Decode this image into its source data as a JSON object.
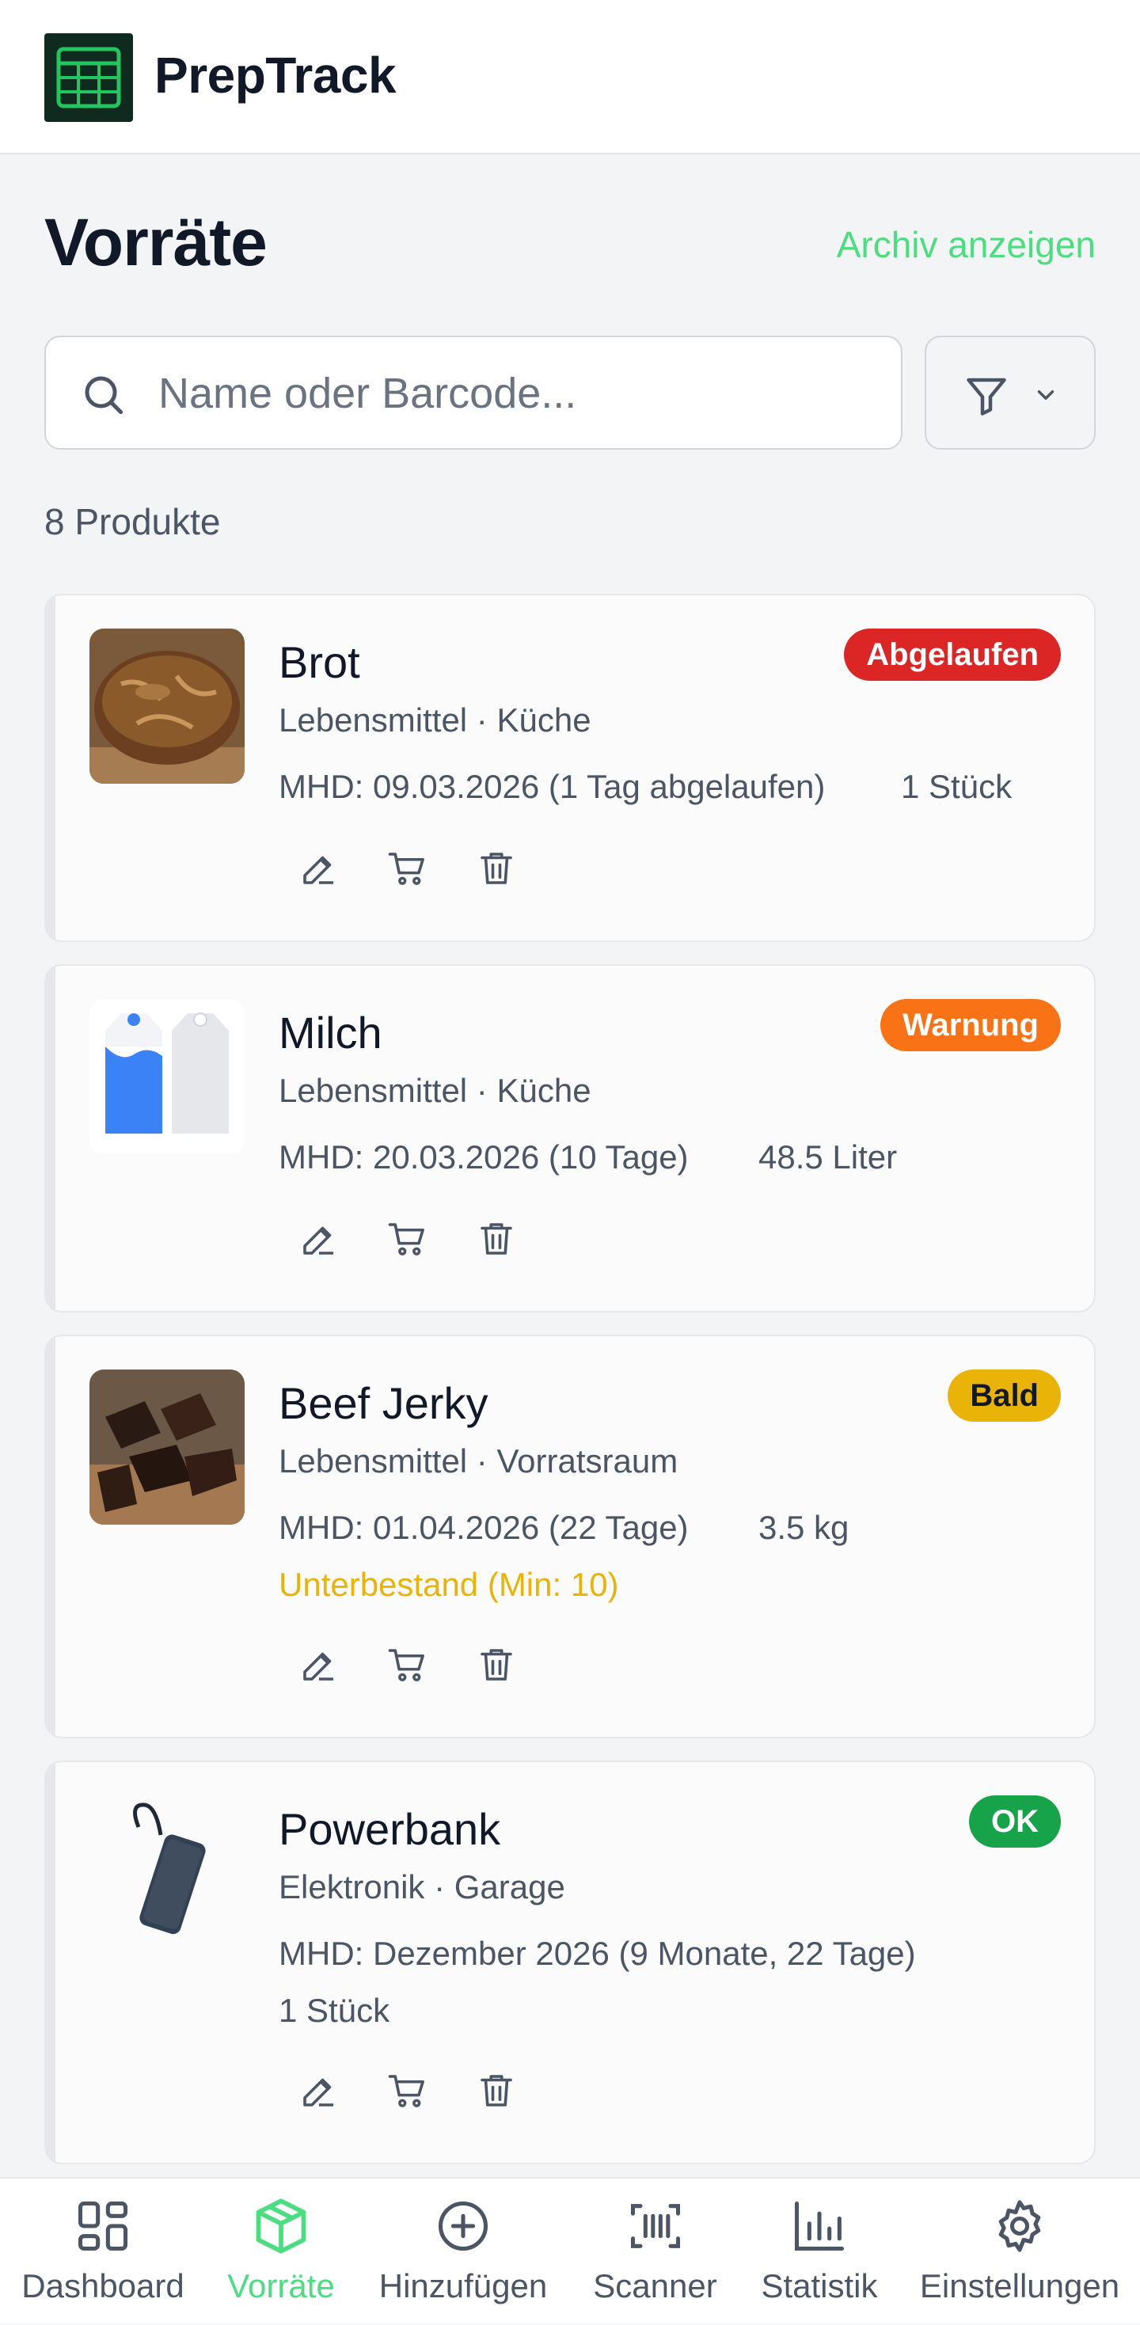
{
  "app": {
    "title": "PrepTrack"
  },
  "page": {
    "title": "Vorräte",
    "archive_link": "Archiv anzeigen"
  },
  "search": {
    "placeholder": "Name oder Barcode...",
    "value": ""
  },
  "list": {
    "count_label": "8 Produkte"
  },
  "colors": {
    "accent": "#4ade80",
    "expired": "#dc2626",
    "warning": "#f97316",
    "soon": "#eab308",
    "ok": "#16a34a"
  },
  "products": [
    {
      "name": "Brot",
      "meta": "Lebensmittel · Küche",
      "mhd": "MHD: 09.03.2026 (1 Tag abgelaufen)",
      "quantity": "1 Stück",
      "status": "Abgelaufen",
      "image": "bread"
    },
    {
      "name": "Milch",
      "meta": "Lebensmittel · Küche",
      "mhd": "MHD: 20.03.2026 (10 Tage)",
      "quantity": "48.5 Liter",
      "status": "Warnung",
      "image": "milk-cartons"
    },
    {
      "name": "Beef Jerky",
      "meta": "Lebensmittel · Vorratsraum",
      "mhd": "MHD: 01.04.2026 (22 Tage)",
      "quantity": "3.5 kg",
      "status": "Bald",
      "stock_warning": "Unterbestand (Min: 10)",
      "image": "beef-jerky"
    },
    {
      "name": "Powerbank",
      "meta": "Elektronik · Garage",
      "mhd": "MHD: Dezember 2026 (9 Monate, 22 Tage)",
      "quantity": "1 Stück",
      "status": "OK",
      "image": "powerbank"
    }
  ],
  "nav": {
    "items": [
      {
        "label": "Dashboard",
        "icon": "grid-icon"
      },
      {
        "label": "Vorräte",
        "icon": "box-icon",
        "active": true
      },
      {
        "label": "Hinzufügen",
        "icon": "plus-circle-icon"
      },
      {
        "label": "Scanner",
        "icon": "barcode-scan-icon"
      },
      {
        "label": "Statistik",
        "icon": "bar-chart-icon"
      },
      {
        "label": "Einstellungen",
        "icon": "gear-icon"
      }
    ]
  }
}
